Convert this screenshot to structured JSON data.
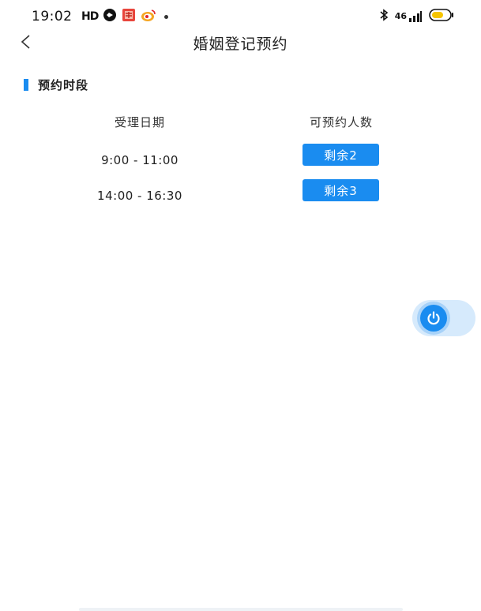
{
  "status_bar": {
    "time": "19:02",
    "hd_label": "HD",
    "signal_label": "46",
    "icons": [
      "hd-icon",
      "circle-app-icon",
      "red-app-icon",
      "weibo-icon",
      "dot-icon",
      "bluetooth-icon",
      "signal-icon",
      "battery-icon"
    ],
    "battery_color": "#f5c400"
  },
  "header": {
    "back_label": "<",
    "title": "婚姻登记预约"
  },
  "section": {
    "title": "预约时段",
    "accent_color": "#1a8cf0"
  },
  "table": {
    "headers": [
      "受理日期",
      "可预约人数"
    ],
    "rows": [
      {
        "time": "9:00 - 11:00",
        "remain": "剩余2"
      },
      {
        "time": "14:00 - 16:30",
        "remain": "剩余3"
      }
    ]
  },
  "float_button": {
    "icon": "power-icon",
    "color": "#1a8cf0"
  }
}
